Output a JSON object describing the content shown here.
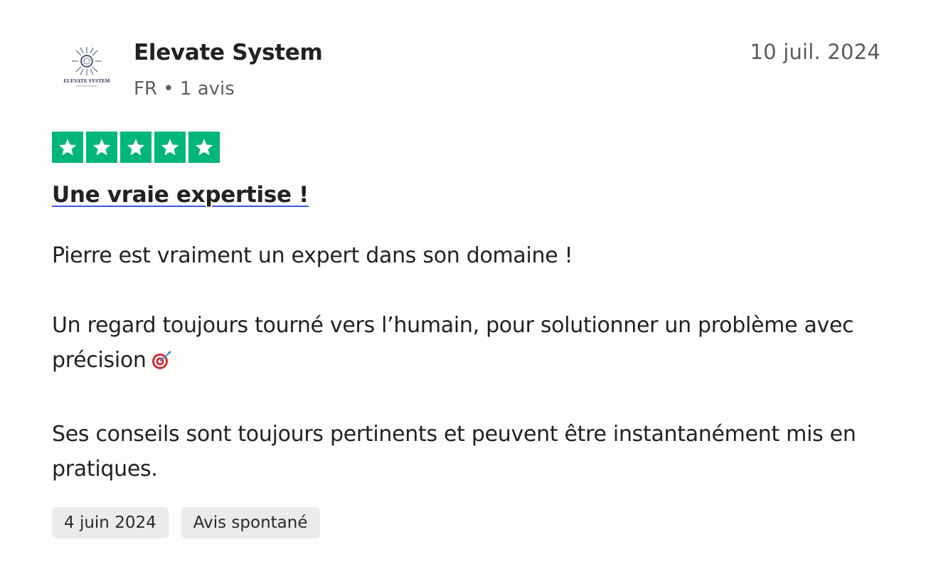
{
  "reviewer": {
    "logo_text": "ELEVATE SYSTEM",
    "logo_subtext": "WEB DEVELOPMENT",
    "name": "Elevate System",
    "country": "FR",
    "separator": "•",
    "review_count": "1 avis"
  },
  "review": {
    "date": "10 juil. 2024",
    "rating": 5,
    "rating_max": 5,
    "star_color": "#00b67a",
    "title": "Une vraie expertise !",
    "paragraphs": [
      "Pierre est vraiment un expert dans son domaine !",
      "Un regard toujours tourné vers l’humain, pour solutionner un problème avec précision",
      "Ses conseils sont toujours pertinents et peuvent être instantanément mis en pratiques."
    ],
    "emoji_icon": "target-dart-icon"
  },
  "tags": {
    "experience_date": "4 juin 2024",
    "review_type": "Avis spontané"
  }
}
